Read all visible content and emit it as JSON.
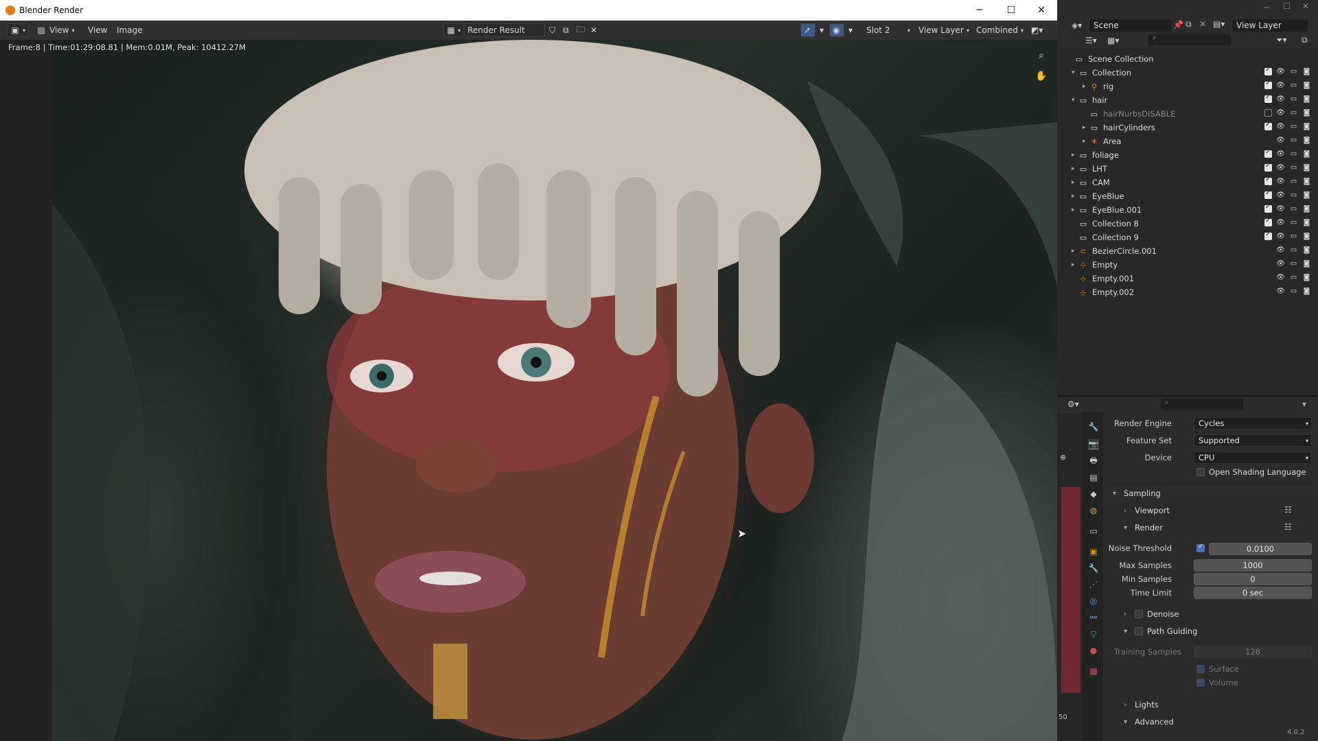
{
  "window": {
    "title": "Blender Render",
    "minimize": "─",
    "maximize": "☐",
    "close": "✕"
  },
  "image_header": {
    "menus": [
      "View",
      "View",
      "Image"
    ],
    "image_name": "Render Result",
    "slot": "Slot 2",
    "view_layer": "View Layer",
    "pass": "Combined"
  },
  "status_line": "Frame:8 | Time:01:29:08.81 | Mem:0.01M, Peak: 10412.27M",
  "right_top": {
    "scene": "Scene",
    "view_layer": "View Layer"
  },
  "outliner": {
    "root": "Scene Collection",
    "rows": [
      {
        "label": "Collection",
        "indent": 1,
        "expanded": "▾",
        "icon": "collection",
        "checked": true
      },
      {
        "label": "rig",
        "indent": 2,
        "expanded": "▸",
        "icon": "armature",
        "checked": true
      },
      {
        "label": "hair",
        "indent": 1,
        "expanded": "▾",
        "icon": "collection",
        "checked": true
      },
      {
        "label": "hairNurbsDISABLE",
        "indent": 2,
        "expanded": "",
        "icon": "collection",
        "checked": false
      },
      {
        "label": "hairCylinders",
        "indent": 2,
        "expanded": "▸",
        "icon": "collection",
        "checked": true
      },
      {
        "label": "Area",
        "indent": 2,
        "expanded": "▸",
        "icon": "light",
        "checked": null
      },
      {
        "label": "foliage",
        "indent": 1,
        "expanded": "▸",
        "icon": "collection",
        "checked": true
      },
      {
        "label": "LHT",
        "indent": 1,
        "expanded": "▸",
        "icon": "collection",
        "checked": true
      },
      {
        "label": "CAM",
        "indent": 1,
        "expanded": "▸",
        "icon": "collection",
        "checked": true
      },
      {
        "label": "EyeBlue",
        "indent": 1,
        "expanded": "▸",
        "icon": "collection",
        "checked": true
      },
      {
        "label": "EyeBlue.001",
        "indent": 1,
        "expanded": "▸",
        "icon": "collection",
        "checked": true
      },
      {
        "label": "Collection 8",
        "indent": 1,
        "expanded": "",
        "icon": "collection",
        "checked": true
      },
      {
        "label": "Collection 9",
        "indent": 1,
        "expanded": "",
        "icon": "collection",
        "checked": true
      },
      {
        "label": "BezierCircle.001",
        "indent": 1,
        "expanded": "▸",
        "icon": "curve",
        "checked": null
      },
      {
        "label": "Empty",
        "indent": 1,
        "expanded": "▸",
        "icon": "empty",
        "checked": null
      },
      {
        "label": "Empty.001",
        "indent": 1,
        "expanded": "",
        "icon": "empty",
        "checked": null
      },
      {
        "label": "Empty.002",
        "indent": 1,
        "expanded": "",
        "icon": "empty",
        "checked": null
      }
    ]
  },
  "properties": {
    "render_engine_label": "Render Engine",
    "render_engine": "Cycles",
    "feature_set_label": "Feature Set",
    "feature_set": "Supported",
    "device_label": "Device",
    "device": "CPU",
    "osl_label": "Open Shading Language",
    "sampling": "Sampling",
    "viewport": "Viewport",
    "render": "Render",
    "noise_threshold_label": "Noise Threshold",
    "noise_threshold": "0.0100",
    "max_samples_label": "Max Samples",
    "max_samples": "1000",
    "min_samples_label": "Min Samples",
    "min_samples": "0",
    "time_limit_label": "Time Limit",
    "time_limit": "0 sec",
    "denoise": "Denoise",
    "path_guiding": "Path Guiding",
    "training_samples_label": "Training Samples",
    "training_samples": "128",
    "surface": "Surface",
    "volume": "Volume",
    "lights": "Lights",
    "advanced": "Advanced"
  },
  "version": "4.0.2",
  "side_value": "50",
  "colors": {
    "accent": "#4772b3",
    "title_bg": "#ffffff",
    "panel": "#2b2b2b"
  }
}
